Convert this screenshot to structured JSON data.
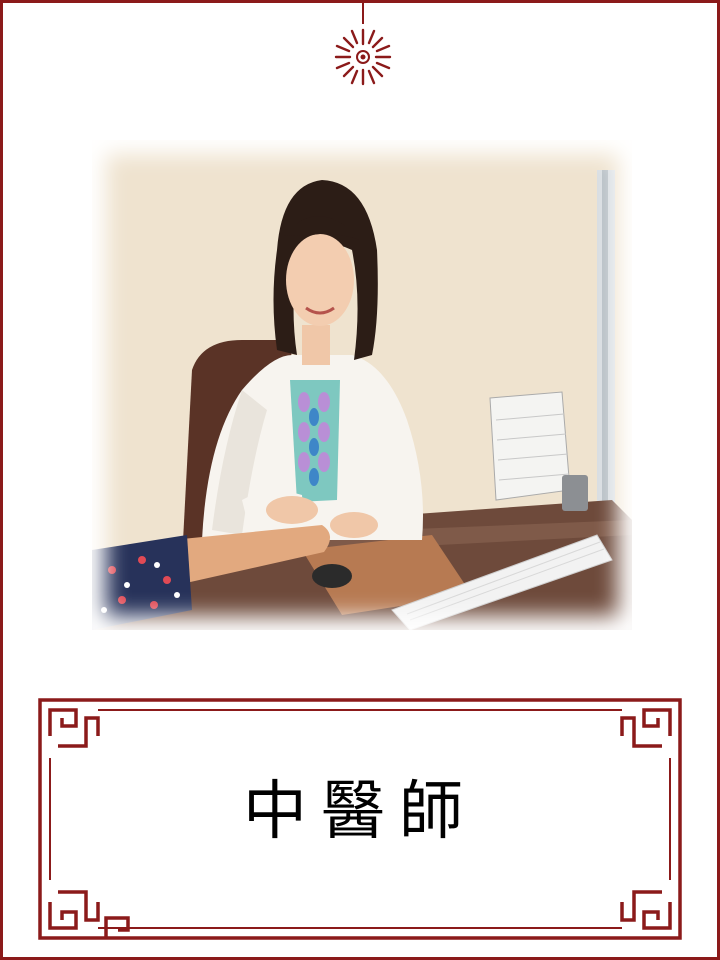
{
  "title": "中醫師",
  "colors": {
    "border": "#8b1a1a",
    "wall": "#efe3cf",
    "coat": "#f7f4ef",
    "desk": "#6e4a3b"
  },
  "icons": {
    "top_ornament": "red-burst-ornament",
    "corner_motif": "chinese-key-fret-corner"
  },
  "photo": {
    "subject": "doctor-consultation"
  }
}
